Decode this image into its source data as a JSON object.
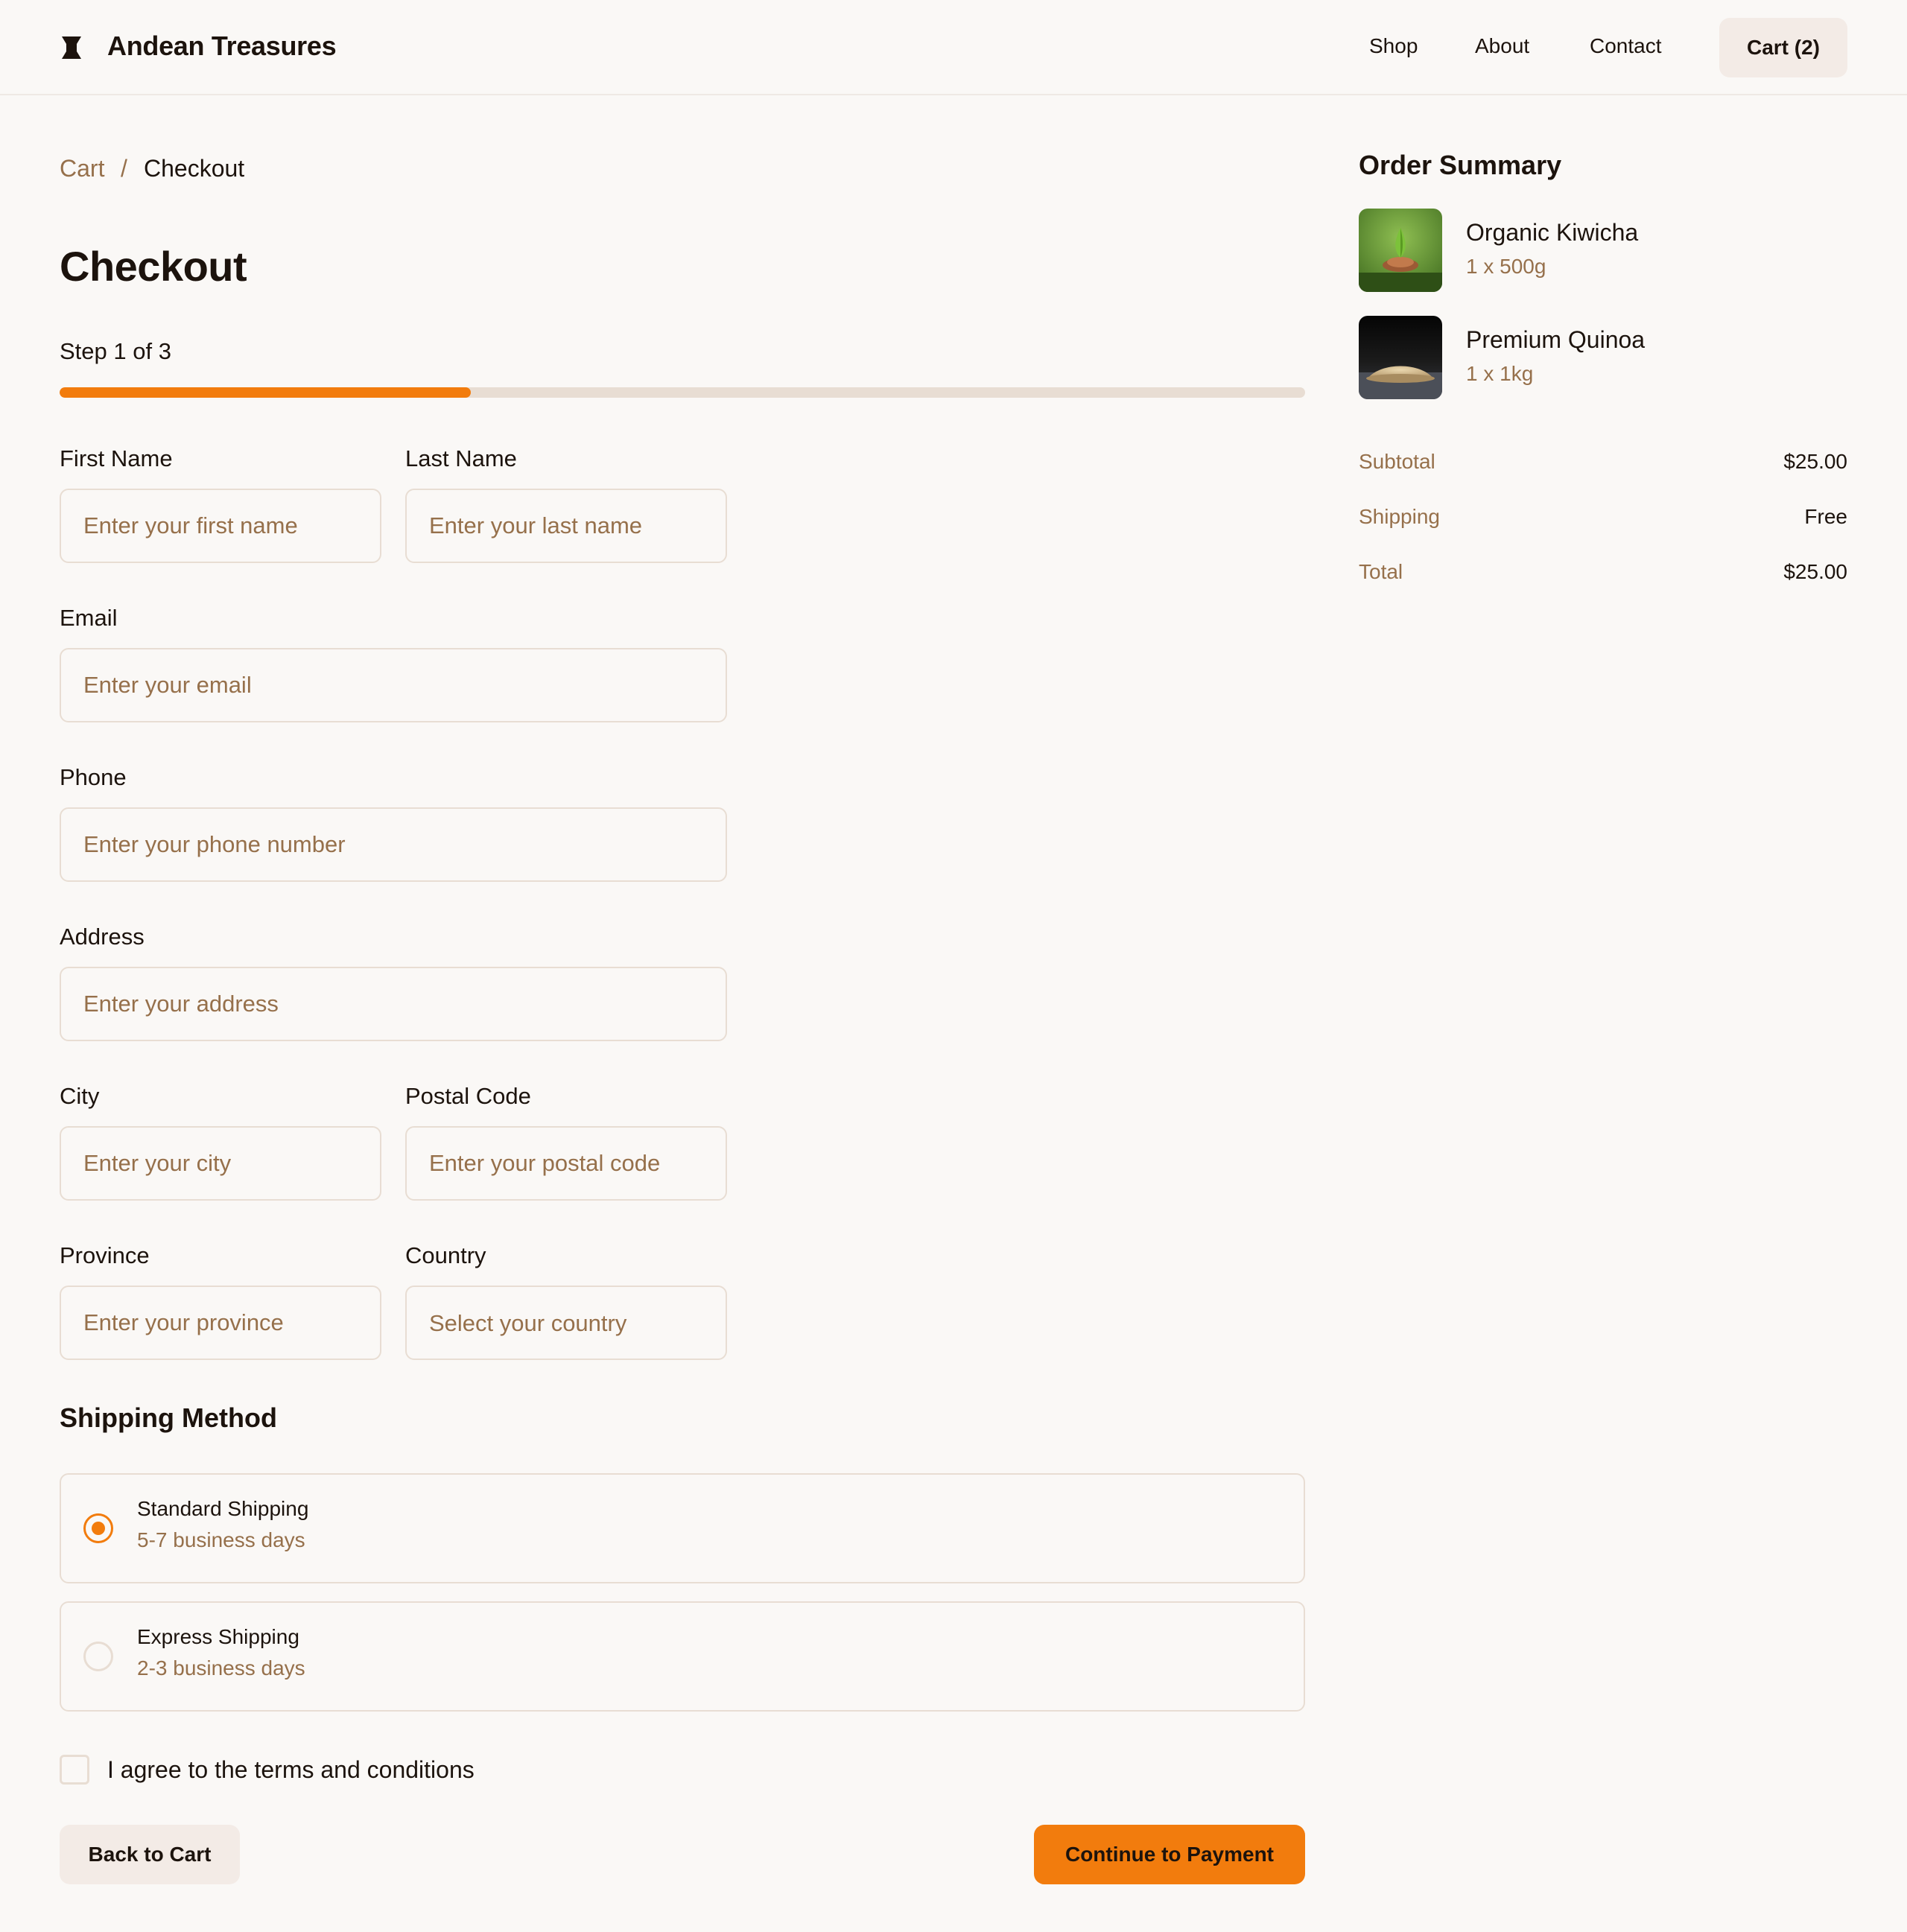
{
  "header": {
    "brand": "Andean Treasures",
    "nav": {
      "shop": "Shop",
      "about": "About",
      "contact": "Contact"
    },
    "cart_label": "Cart (2)"
  },
  "breadcrumb": {
    "cart": "Cart",
    "separator": "/",
    "current": "Checkout"
  },
  "page_title": "Checkout",
  "progress": {
    "step_text": "Step 1 of 3",
    "fraction": 0.33
  },
  "form": {
    "first_name": {
      "label": "First Name",
      "placeholder": "Enter your first name"
    },
    "last_name": {
      "label": "Last Name",
      "placeholder": "Enter your last name"
    },
    "email": {
      "label": "Email",
      "placeholder": "Enter your email"
    },
    "phone": {
      "label": "Phone",
      "placeholder": "Enter your phone number"
    },
    "address": {
      "label": "Address",
      "placeholder": "Enter your address"
    },
    "city": {
      "label": "City",
      "placeholder": "Enter your city"
    },
    "postal_code": {
      "label": "Postal Code",
      "placeholder": "Enter your postal code"
    },
    "province": {
      "label": "Province",
      "placeholder": "Enter your province"
    },
    "country": {
      "label": "Country",
      "selected": "Select your country"
    }
  },
  "shipping": {
    "title": "Shipping Method",
    "options": [
      {
        "name": "Standard Shipping",
        "detail": "5-7 business days",
        "selected": true
      },
      {
        "name": "Express Shipping",
        "detail": "2-3 business days",
        "selected": false
      }
    ]
  },
  "terms_label": "I agree to the terms and conditions",
  "actions": {
    "back": "Back to Cart",
    "continue": "Continue to Payment"
  },
  "summary": {
    "title": "Order Summary",
    "items": [
      {
        "name": "Organic Kiwicha",
        "qty": "1 x 500g",
        "image": "kiwicha-photo"
      },
      {
        "name": "Premium Quinoa",
        "qty": "1 x 1kg",
        "image": "quinoa-photo"
      }
    ],
    "rows": [
      {
        "label": "Subtotal",
        "value": "$25.00"
      },
      {
        "label": "Shipping",
        "value": "Free"
      },
      {
        "label": "Total",
        "value": "$25.00"
      }
    ]
  },
  "colors": {
    "accent": "#f27c0d",
    "muted_text": "#96704b",
    "border": "#e8ddd3",
    "background": "#faf8f6",
    "secondary_button": "#f3ebe6"
  }
}
